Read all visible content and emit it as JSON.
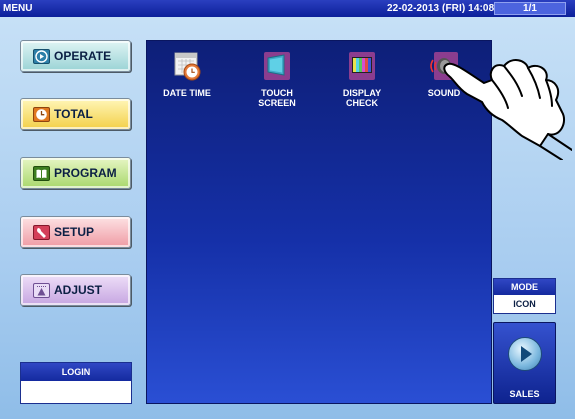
{
  "topbar": {
    "title": "MENU",
    "datetime": "22-02-2013 (FRI)  14:08",
    "page": "1/1"
  },
  "left_menu": [
    {
      "label": "OPERATE",
      "icon": "play-icon"
    },
    {
      "label": "TOTAL",
      "icon": "clock-icon"
    },
    {
      "label": "PROGRAM",
      "icon": "book-icon"
    },
    {
      "label": "SETUP",
      "icon": "wrench-icon"
    },
    {
      "label": "ADJUST",
      "icon": "scale-icon"
    }
  ],
  "login": {
    "label": "LOGIN",
    "value": ""
  },
  "tiles": [
    {
      "label1": "DATE TIME",
      "label2": "",
      "icon": "calendar-clock-icon"
    },
    {
      "label1": "TOUCH",
      "label2": "SCREEN",
      "icon": "touch-screen-icon"
    },
    {
      "label1": "DISPLAY",
      "label2": "CHECK",
      "icon": "display-check-icon"
    },
    {
      "label1": "SOUND",
      "label2": "",
      "icon": "speaker-icon"
    }
  ],
  "mode": {
    "label": "MODE",
    "value": "ICON"
  },
  "sales": {
    "label": "SALES",
    "icon": "sales-arrow-icon"
  }
}
